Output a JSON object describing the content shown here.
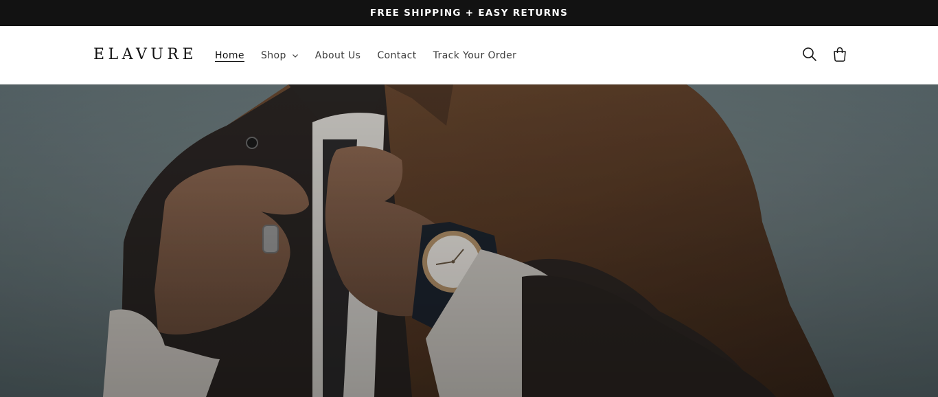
{
  "announcement": {
    "text": "FREE SHIPPING + EASY RETURNS"
  },
  "header": {
    "logo": "ELAVURE",
    "nav": {
      "home": "Home",
      "shop": "Shop",
      "about": "About Us",
      "contact": "Contact",
      "track": "Track Your Order"
    },
    "icons": {
      "search": "search-icon",
      "cart": "cart-icon",
      "shop_dropdown": "chevron-down-icon"
    }
  },
  "colors": {
    "announcement_bg": "#121212",
    "text_primary": "#121212",
    "text_nav": "#3a3a3a",
    "header_bg": "#ffffff"
  }
}
